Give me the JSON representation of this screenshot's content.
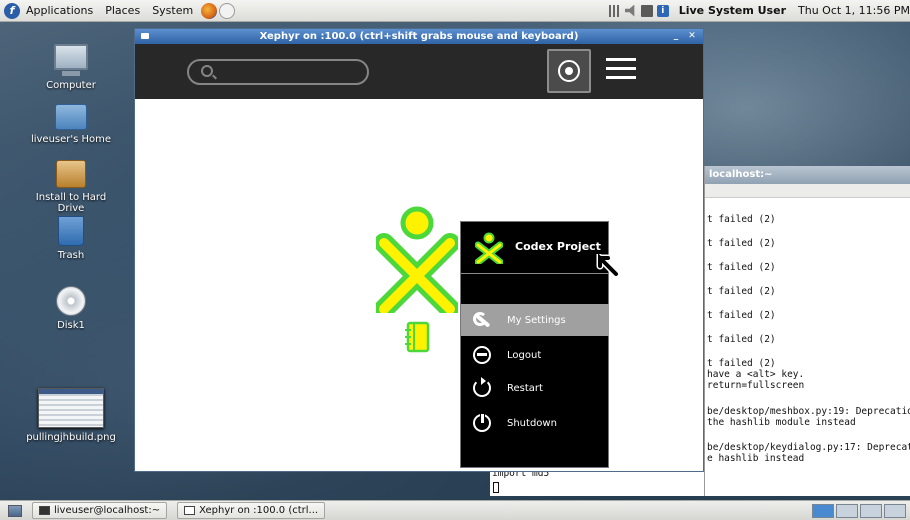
{
  "top_panel": {
    "menus": [
      "Applications",
      "Places",
      "System"
    ],
    "user": "Live System User",
    "clock": "Thu Oct  1, 11:56 PM"
  },
  "desktop_icons": [
    {
      "label": "Computer",
      "icon": "computer-icon"
    },
    {
      "label": "liveuser's Home",
      "icon": "home-folder-icon"
    },
    {
      "label": "Install to Hard Drive",
      "icon": "installer-icon"
    },
    {
      "label": "Trash",
      "icon": "trash-icon"
    },
    {
      "label": "Disk1",
      "icon": "dvd-disk-icon"
    },
    {
      "label": "pullingjhbuild.png",
      "icon": "image-file-icon"
    }
  ],
  "xephyr": {
    "title": "Xephyr on :100.0 (ctrl+shift grabs mouse and keyboard)",
    "search_placeholder": ""
  },
  "palette": {
    "title": "Codex Project",
    "items": [
      "My Settings",
      "Logout",
      "Restart",
      "Shutdown"
    ],
    "selected": "My Settings"
  },
  "terminal": {
    "title": "localhost:~",
    "lines": [
      "t failed (2)",
      "t failed (2)",
      "t failed (2)",
      "t failed (2)",
      "t failed (2)",
      "t failed (2)",
      "t failed (2)",
      " have a <alt> key.",
      "return=fullscreen",
      "be/desktop/meshbox.py:19: Deprecatio",
      "the hashlib module instead",
      "be/desktop/keydialog.py:17: Deprecat",
      "e hashlib instead"
    ],
    "bottom_line": "import md5"
  },
  "taskbar": {
    "tasks": [
      "liveuser@localhost:~",
      "Xephyr on :100.0 (ctrl..."
    ]
  },
  "colors": {
    "sugar_toolbar": "#282828",
    "xo_stroke": "#4CD83A",
    "xo_fill": "#FFF200",
    "palette_bg": "#000000",
    "palette_selected": "#a0a0a0"
  }
}
